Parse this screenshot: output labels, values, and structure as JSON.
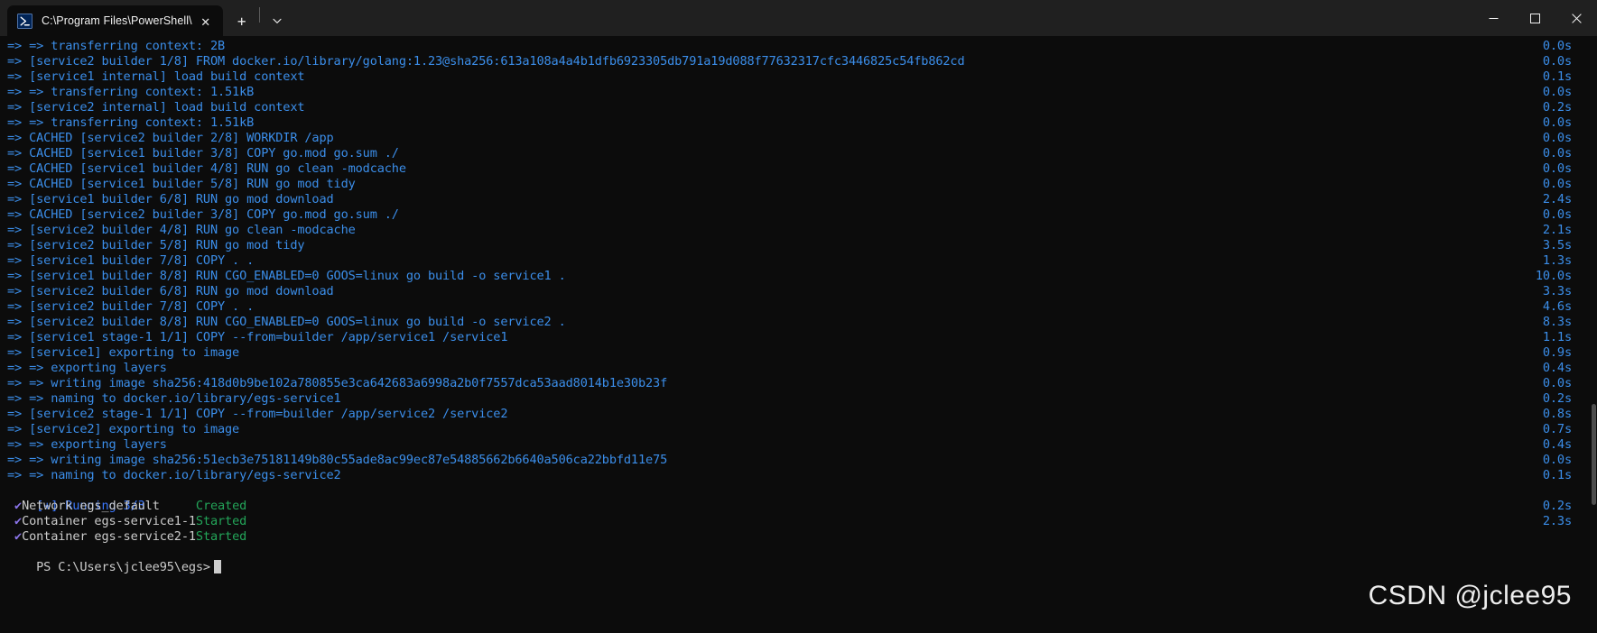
{
  "window": {
    "title": "C:\\Program Files\\PowerShell\\",
    "tab_icon": "powershell-icon",
    "close_tab_label": "✕",
    "new_tab_label": "+",
    "dropdown_label": "⌄",
    "minimize_label": "─",
    "maximize_label": "□",
    "close_label": "✕"
  },
  "colors": {
    "background": "#0c0c0c",
    "titlebar": "#202020",
    "blue": "#3b8eea",
    "white": "#cccccc",
    "green": "#23a559",
    "purple": "#8d7cf0",
    "check": "#8a74e8"
  },
  "watermark": "CSDN @jclee95",
  "terminal": {
    "prompt": "PS C:\\Users\\jclee95\\egs>",
    "running_header": "[+] Running 3/3",
    "build_lines": [
      {
        "text": "=> => transferring context: 2B",
        "time": "0.0s"
      },
      {
        "text": "=> [service2 builder 1/8] FROM docker.io/library/golang:1.23@sha256:613a108a4a4b1dfb6923305db791a19d088f77632317cfc3446825c54fb862cd",
        "time": "0.0s"
      },
      {
        "text": "=> [service1 internal] load build context",
        "time": "0.1s"
      },
      {
        "text": "=> => transferring context: 1.51kB",
        "time": "0.0s"
      },
      {
        "text": "=> [service2 internal] load build context",
        "time": "0.2s"
      },
      {
        "text": "=> => transferring context: 1.51kB",
        "time": "0.0s"
      },
      {
        "text": "=> CACHED [service2 builder 2/8] WORKDIR /app",
        "time": "0.0s"
      },
      {
        "text": "=> CACHED [service1 builder 3/8] COPY go.mod go.sum ./",
        "time": "0.0s"
      },
      {
        "text": "=> CACHED [service1 builder 4/8] RUN go clean -modcache",
        "time": "0.0s"
      },
      {
        "text": "=> CACHED [service1 builder 5/8] RUN go mod tidy",
        "time": "0.0s"
      },
      {
        "text": "=> [service1 builder 6/8] RUN go mod download",
        "time": "2.4s"
      },
      {
        "text": "=> CACHED [service2 builder 3/8] COPY go.mod go.sum ./",
        "time": "0.0s"
      },
      {
        "text": "=> [service2 builder 4/8] RUN go clean -modcache",
        "time": "2.1s"
      },
      {
        "text": "=> [service2 builder 5/8] RUN go mod tidy",
        "time": "3.5s"
      },
      {
        "text": "=> [service1 builder 7/8] COPY . .",
        "time": "1.3s"
      },
      {
        "text": "=> [service1 builder 8/8] RUN CGO_ENABLED=0 GOOS=linux go build -o service1 .",
        "time": "10.0s"
      },
      {
        "text": "=> [service2 builder 6/8] RUN go mod download",
        "time": "3.3s"
      },
      {
        "text": "=> [service2 builder 7/8] COPY . .",
        "time": "4.6s"
      },
      {
        "text": "=> [service2 builder 8/8] RUN CGO_ENABLED=0 GOOS=linux go build -o service2 .",
        "time": "8.3s"
      },
      {
        "text": "=> [service1 stage-1 1/1] COPY --from=builder /app/service1 /service1",
        "time": "1.1s"
      },
      {
        "text": "=> [service1] exporting to image",
        "time": "0.9s"
      },
      {
        "text": "=> => exporting layers",
        "time": "0.4s"
      },
      {
        "text": "=> => writing image sha256:418d0b9be102a780855e3ca642683a6998a2b0f7557dca53aad8014b1e30b23f",
        "time": "0.0s"
      },
      {
        "text": "=> => naming to docker.io/library/egs-service1",
        "time": "0.2s"
      },
      {
        "text": "=> [service2 stage-1 1/1] COPY --from=builder /app/service2 /service2",
        "time": "0.8s"
      },
      {
        "text": "=> [service2] exporting to image",
        "time": "0.7s"
      },
      {
        "text": "=> => exporting layers",
        "time": "0.4s"
      },
      {
        "text": "=> => writing image sha256:51ecb3e75181149b80c55ade8ac99ec87e54885662b6640a506ca22bbfd11e75",
        "time": "0.0s"
      },
      {
        "text": "=> => naming to docker.io/library/egs-service2",
        "time": "0.1s"
      }
    ],
    "resources": [
      {
        "check": "✔",
        "kind_name": "Network egs_default",
        "status": "Created",
        "time": "0.2s"
      },
      {
        "check": "✔",
        "kind_name": "Container egs-service1-1",
        "status": "Started",
        "time": "2.3s"
      },
      {
        "check": "✔",
        "kind_name": "Container egs-service2-1",
        "status": "Started",
        "time": ""
      }
    ]
  }
}
